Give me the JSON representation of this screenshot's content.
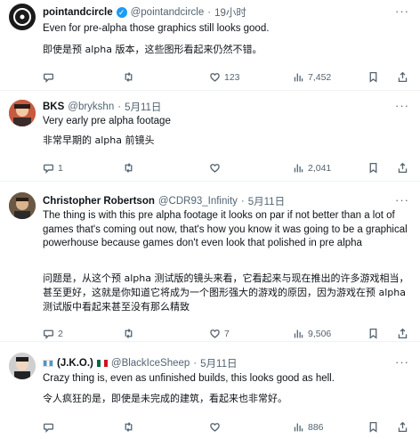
{
  "tweets": [
    {
      "name": "pointandcircle",
      "handle": "@pointandcircle",
      "time": "19小时",
      "verified": true,
      "text_en": "Even for pre-alpha those graphics still looks good.",
      "text_zh": "即使是预 alpha 版本，这些图形看起来仍然不错。",
      "replies": "",
      "retweets": "",
      "likes": "123",
      "views": "7,452"
    },
    {
      "name": "BKS",
      "handle": "@brykshn",
      "time": "5月11日",
      "text_en": "Very early pre alpha footage",
      "text_zh": "非常早期的 alpha 前镜头",
      "replies": "1",
      "retweets": "",
      "likes": "",
      "views": "2,041"
    },
    {
      "name": "Christopher Robertson",
      "handle": "@CDR93_Infinity",
      "time": "5月11日",
      "text_en": "The thing is with this pre alpha footage it looks on par if not better than a lot of games that's coming out now, that's how you know it was going to be a graphical powerhouse because games don't even look that polished in pre alpha",
      "text_zh": "问题是，从这个预 alpha 测试版的镜头来看，它看起来与现在推出的许多游戏相当，甚至更好，这就是你知道它将成为一个图形强大的游戏的原因，因为游戏在预 alpha 测试版中看起来甚至没有那么精致",
      "replies": "2",
      "retweets": "",
      "likes": "7",
      "views": "9,506"
    },
    {
      "name": "(J.K.O.)",
      "handle": "@BlackIceSheep",
      "time": "5月11日",
      "text_en": "Crazy thing is, even as unfinished builds, this looks good as hell.",
      "text_zh": "令人疯狂的是，即使是未完成的建筑，看起来也非常好。",
      "replies": "",
      "retweets": "",
      "likes": "",
      "views": "886"
    }
  ],
  "separator": "·",
  "more_label": "···",
  "colors": {
    "text": "#0f1419",
    "muted": "#536471",
    "verified": "#1d9bf0",
    "divider": "#eff3f4"
  },
  "icons": [
    "reply-icon",
    "retweet-icon",
    "like-icon",
    "views-icon",
    "bookmark-icon",
    "share-icon",
    "verified-badge-icon",
    "more-icon"
  ]
}
